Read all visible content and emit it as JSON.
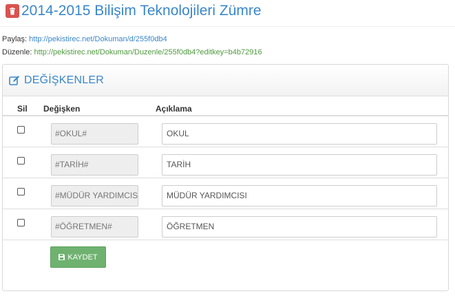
{
  "header": {
    "title": "2014-2015 Bilişim Teknolojileri Zümre"
  },
  "links": {
    "paylas_label": "Paylaş:",
    "paylas_url": "http://pekistirec.net/Dokuman/d/255f0db4",
    "duzenle_label": "Düzenle:",
    "duzenle_url": "http://pekistirec.net/Dokuman/Duzenle/255f0db4?editkey=b4b72916"
  },
  "panel": {
    "title": "DEĞİŞKENLER",
    "columns": {
      "sil": "Sil",
      "degisken": "Değişken",
      "aciklama": "Açıklama"
    },
    "rows": [
      {
        "variable": "#OKUL#",
        "description": "OKUL",
        "checked": false
      },
      {
        "variable": "#TARİH#",
        "description": "TARİH",
        "checked": false
      },
      {
        "variable": "#MÜDÜR YARDIMCISI#",
        "description": "MÜDÜR YARDIMCISI",
        "checked": false
      },
      {
        "variable": "#ÖĞRETMEN#",
        "description": "ÖĞRETMEN",
        "checked": false
      }
    ],
    "save_label": "KAYDET"
  },
  "icons": {
    "delete": "trash-icon",
    "panel": "edit-icon",
    "save": "floppy-disk-icon"
  },
  "colors": {
    "title_blue": "#3a87c9",
    "link_green": "#4e9a3e",
    "delete_red": "#d9534f",
    "save_green": "#6fb270"
  }
}
